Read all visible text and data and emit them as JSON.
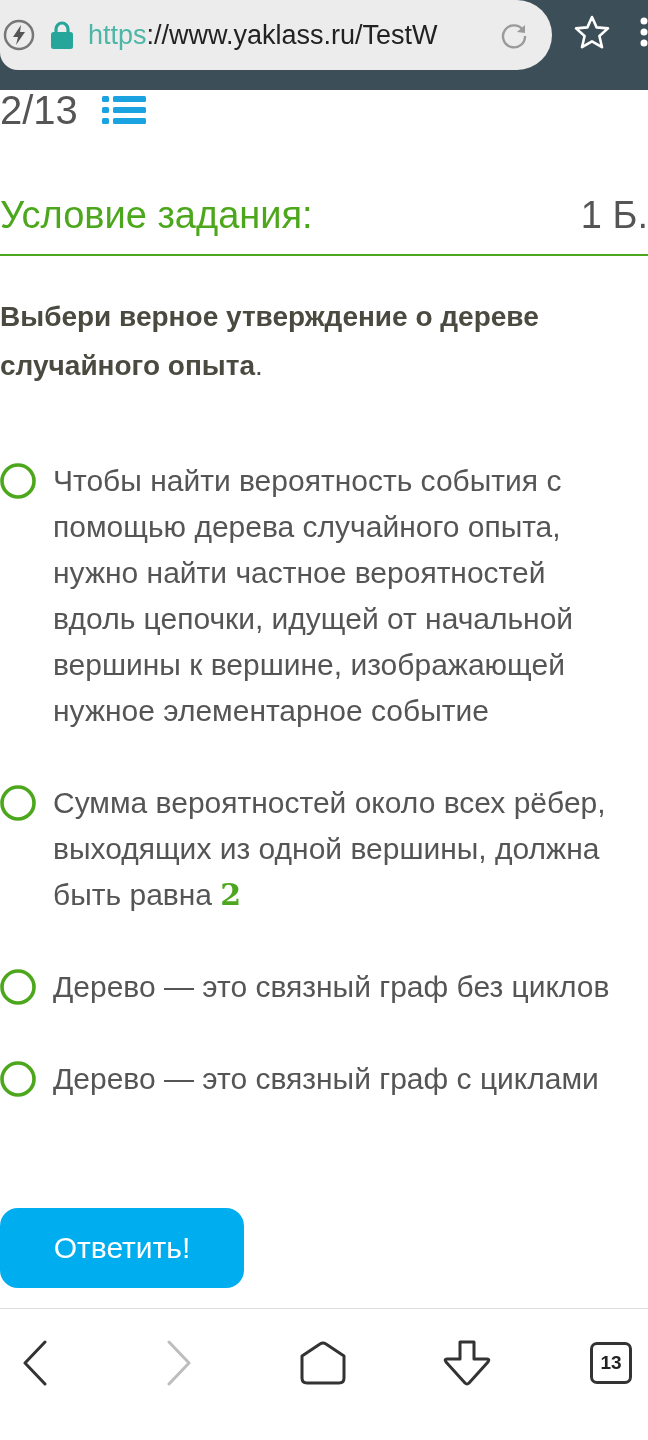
{
  "browser_bar": {
    "url": {
      "scheme": "https",
      "address": "://www.yaklass.ru/TestW"
    }
  },
  "progress": {
    "counter": "2/13"
  },
  "task": {
    "heading": "Условие задания:",
    "points": "1 Б.",
    "question": "**Выбери верное утверждение о дереве случайного опыта**."
  },
  "options": [
    {
      "text": "Чтобы найти вероятность события с помощью дерева случайного опыта, нужно найти частное вероятностей вдоль цепочки, идущей от начальной вершины к вершине, изображающей нужное элементарное событие",
      "selected": false
    },
    {
      "text": "Сумма вероятностей около всех рёбер, выходящих из одной вершины, должна быть равна",
      "math": "2",
      "selected": false
    },
    {
      "text": "Дерево — это связный граф без циклов",
      "selected": false
    },
    {
      "text": "Дерево — это связный граф с циклами",
      "selected": false
    }
  ],
  "submit_button": "Ответить!",
  "navigation": {
    "back": {
      "disabled": false
    },
    "forward": {
      "disabled": true
    },
    "tabs_count": "13"
  }
}
